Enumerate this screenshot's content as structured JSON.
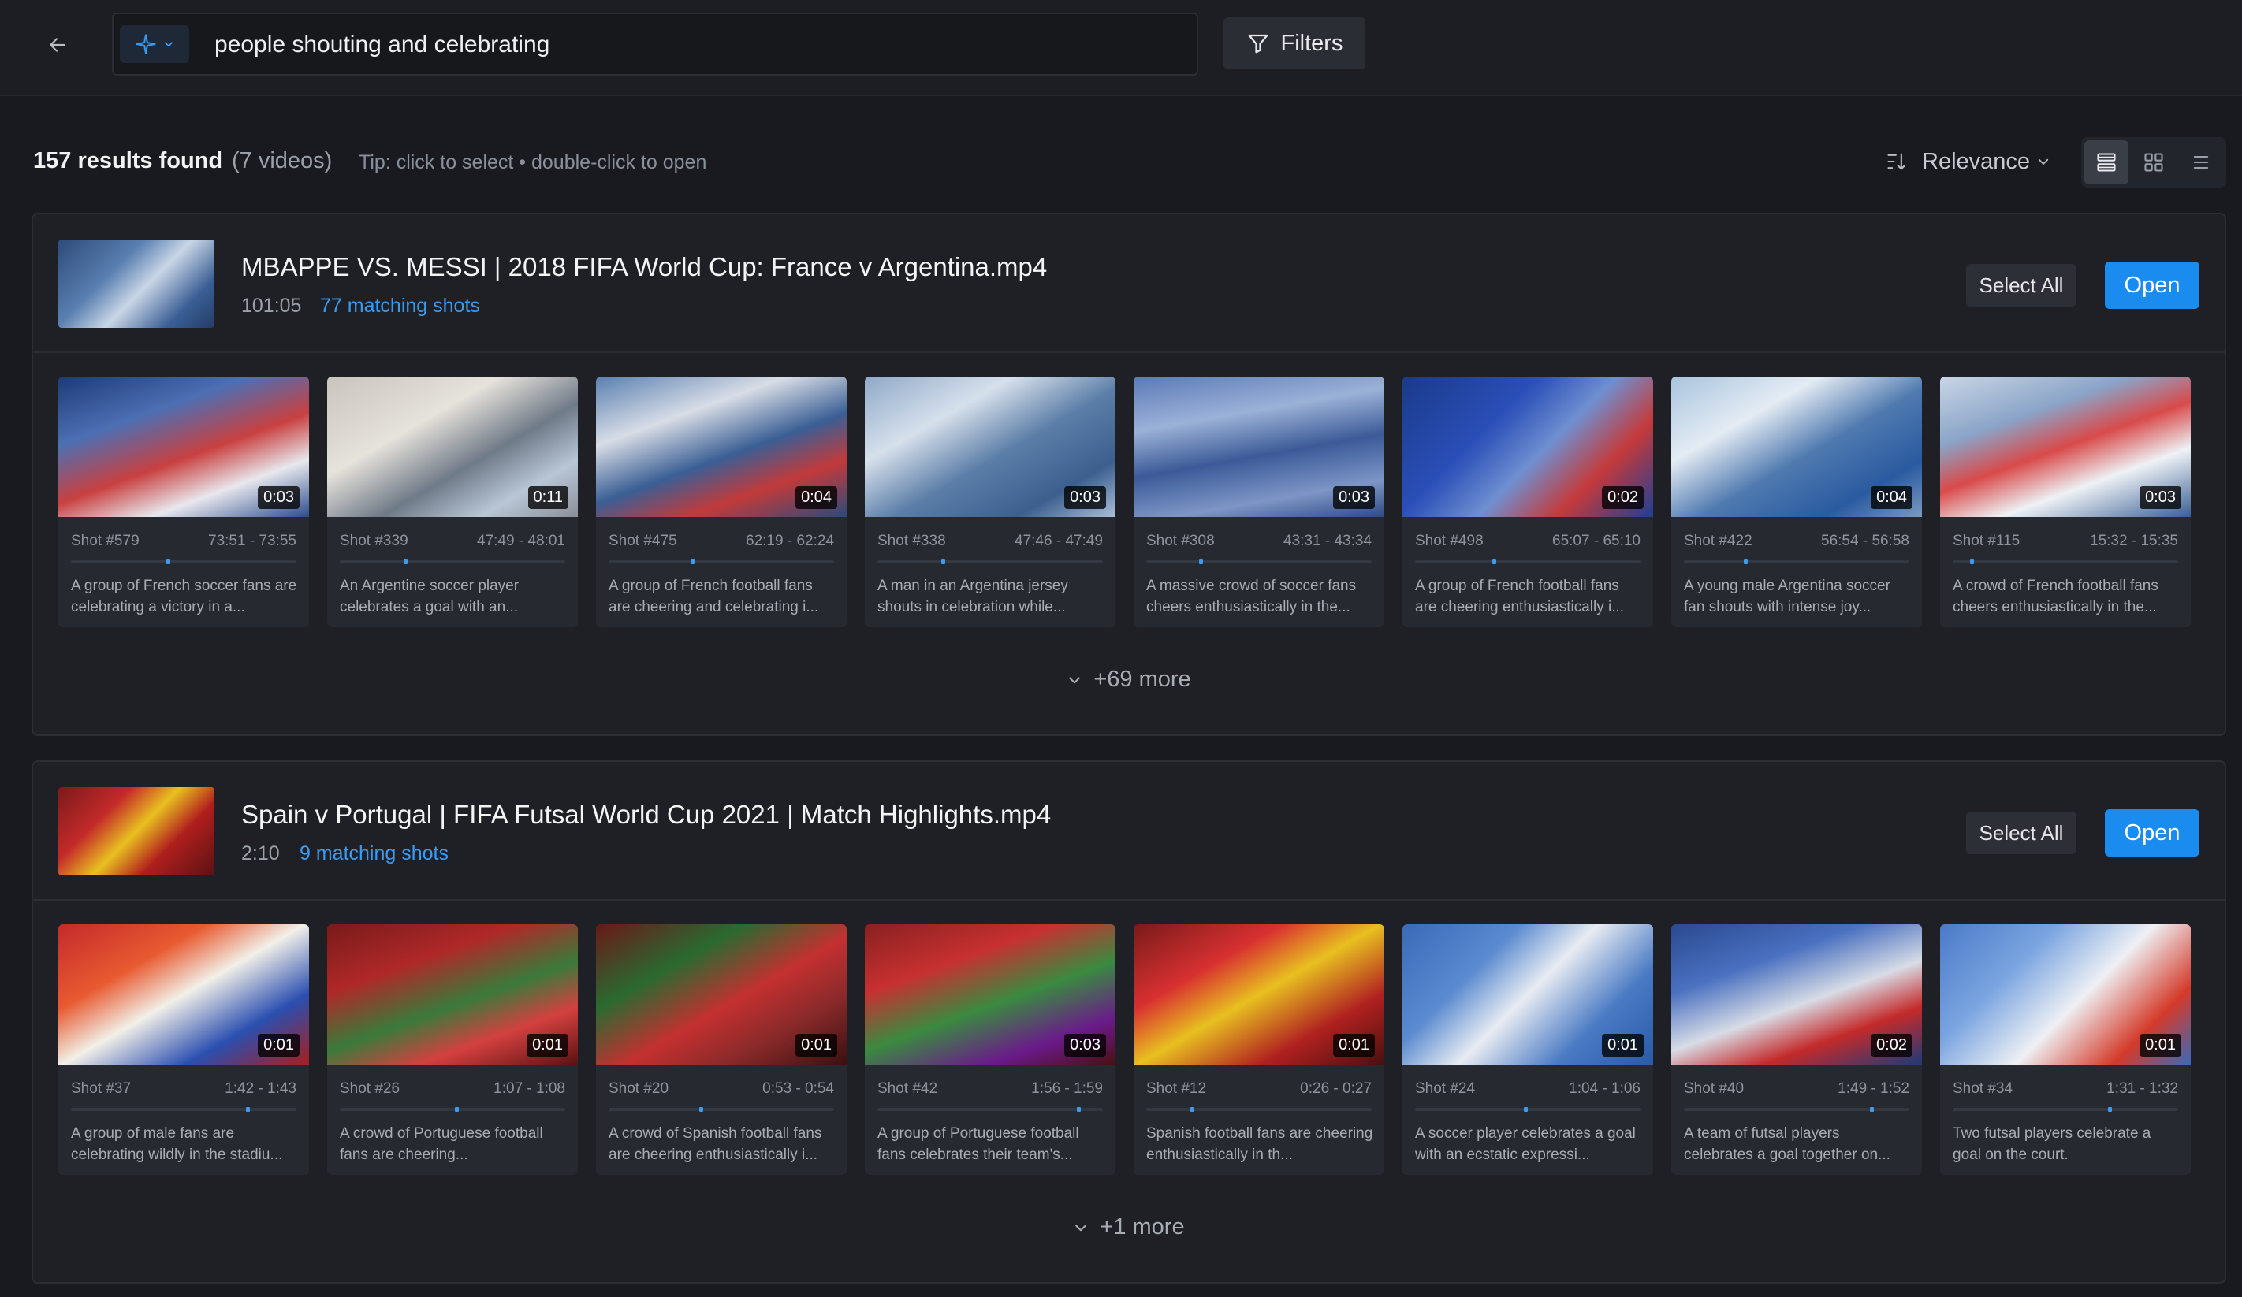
{
  "search": {
    "query": "people shouting and celebrating",
    "filters_label": "Filters"
  },
  "results": {
    "count": "157 results found",
    "videos": "(7 videos)",
    "tip": "Tip: click to select • double-click to open",
    "sort_label": "Relevance"
  },
  "groups": [
    {
      "title": "MBAPPE VS. MESSI  |  2018 FIFA World Cup:  France v Argentina.mp4",
      "duration": "101:05",
      "matching": "77 matching shots",
      "select_all": "Select All",
      "open": "Open",
      "more": "+69 more",
      "shots": [
        {
          "dur": "0:03",
          "shot": "Shot #579",
          "range": "73:51 - 73:55",
          "desc": "A group of French soccer fans are celebrating a victory in a...",
          "marker": 0.43
        },
        {
          "dur": "0:11",
          "shot": "Shot #339",
          "range": "47:49 - 48:01",
          "desc": "An Argentine soccer player celebrates a goal with an...",
          "marker": 0.29
        },
        {
          "dur": "0:04",
          "shot": "Shot #475",
          "range": "62:19 - 62:24",
          "desc": "A group of French football fans are cheering and celebrating i...",
          "marker": 0.37
        },
        {
          "dur": "0:03",
          "shot": "Shot #338",
          "range": "47:46 - 47:49",
          "desc": "A man in an Argentina jersey shouts in celebration while...",
          "marker": 0.29
        },
        {
          "dur": "0:03",
          "shot": "Shot #308",
          "range": "43:31 - 43:34",
          "desc": "A massive crowd of soccer fans cheers enthusiastically in the...",
          "marker": 0.24
        },
        {
          "dur": "0:02",
          "shot": "Shot #498",
          "range": "65:07 - 65:10",
          "desc": "A group of French football fans are cheering enthusiastically i...",
          "marker": 0.35
        },
        {
          "dur": "0:04",
          "shot": "Shot #422",
          "range": "56:54 - 56:58",
          "desc": "A young male Argentina soccer fan shouts with intense joy...",
          "marker": 0.27
        },
        {
          "dur": "0:03",
          "shot": "Shot #115",
          "range": "15:32 - 15:35",
          "desc": "A crowd of French football fans cheers enthusiastically in the...",
          "marker": 0.08
        }
      ]
    },
    {
      "title": "Spain v Portugal | FIFA Futsal World Cup 2021 | Match Highlights.mp4",
      "duration": "2:10",
      "matching": "9 matching shots",
      "select_all": "Select All",
      "open": "Open",
      "more": "+1 more",
      "shots": [
        {
          "dur": "0:01",
          "shot": "Shot #37",
          "range": "1:42 - 1:43",
          "desc": "A group of male fans are celebrating wildly in the stadiu...",
          "marker": 0.79
        },
        {
          "dur": "0:01",
          "shot": "Shot #26",
          "range": "1:07 - 1:08",
          "desc": "A crowd of Portuguese football fans are cheering...",
          "marker": 0.52
        },
        {
          "dur": "0:01",
          "shot": "Shot #20",
          "range": "0:53 - 0:54",
          "desc": "A crowd of Spanish football fans are cheering enthusiastically i...",
          "marker": 0.41
        },
        {
          "dur": "0:03",
          "shot": "Shot #42",
          "range": "1:56 - 1:59",
          "desc": "A group of Portuguese football fans celebrates their team's...",
          "marker": 0.9
        },
        {
          "dur": "0:01",
          "shot": "Shot #12",
          "range": "0:26 - 0:27",
          "desc": "Spanish football fans are cheering enthusiastically in th...",
          "marker": 0.2
        },
        {
          "dur": "0:01",
          "shot": "Shot #24",
          "range": "1:04 - 1:06",
          "desc": "A soccer player celebrates a goal with an ecstatic expressi...",
          "marker": 0.49
        },
        {
          "dur": "0:02",
          "shot": "Shot #40",
          "range": "1:49 - 1:52",
          "desc": "A team of futsal players celebrates a goal together on...",
          "marker": 0.84
        },
        {
          "dur": "0:01",
          "shot": "Shot #34",
          "range": "1:31 - 1:32",
          "desc": "Two futsal players celebrate a goal on the court.",
          "marker": 0.7
        }
      ]
    }
  ],
  "colors": {
    "accent": "#1a8cf0",
    "link": "#3a9bf0",
    "background": "#181a1f",
    "panel": "#1e2025"
  },
  "icons": {
    "back": "arrow-left-icon",
    "mode": "sparkle-icon",
    "filter": "funnel-icon",
    "sort": "sort-icon",
    "views": [
      "grouped-view-icon",
      "grid-view-icon",
      "list-view-icon"
    ]
  }
}
